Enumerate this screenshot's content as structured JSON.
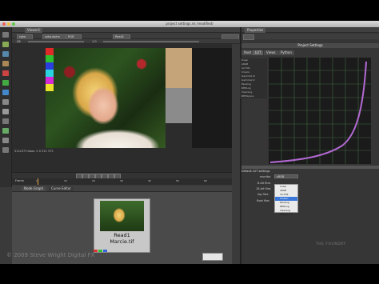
{
  "window": {
    "title": "project settings.nk (modified)"
  },
  "viewer": {
    "tab": "Viewer1",
    "controls": [
      "rgba",
      "rgba.alpha",
      "RGB",
      "Read1"
    ],
    "info": "512x373 bbox: 0 0 512 373",
    "gain_label": "f/8",
    "frame_label": "1.0"
  },
  "timeline": {
    "label": "Frame",
    "ticks": [
      "1",
      "10",
      "20",
      "30",
      "40",
      "50",
      "60"
    ]
  },
  "node_graph": {
    "tabs": [
      "Node Graph",
      "Curve Editor"
    ],
    "node": {
      "name": "Read1",
      "file": "Marcie.tif"
    }
  },
  "properties": {
    "title": "Properties",
    "panel_title": "Project Settings",
    "tabs": [
      "Root",
      "LUT",
      "Views",
      "Python"
    ],
    "lut_list": [
      "linear",
      "sRGB",
      "rec709",
      "Cineon",
      "Gamma1.8",
      "Gamma2.2",
      "Panalog",
      "REDLog",
      "ViperLog",
      "REDSpace"
    ],
    "default_label": "Default LUT settings",
    "fields": [
      {
        "label": "monitor",
        "value": "sRGB"
      },
      {
        "label": "8-bit files",
        "value": "sRGB"
      },
      {
        "label": "16-bit files",
        "value": "sRGB"
      },
      {
        "label": "log files",
        "value": "Cineon"
      },
      {
        "label": "float files",
        "value": "linear"
      }
    ],
    "popup_options": [
      "linear",
      "sRGB",
      "rec709",
      "Cineon",
      "Panalog",
      "REDLog",
      "ViperLog",
      "REDSpace"
    ],
    "popup_selected": "Cineon"
  },
  "watermark": {
    "copyright": "© 2009 Steve Wright Digital FX",
    "brand": "THE FOUNDRY"
  },
  "colors": {
    "curve": "#b36ad3",
    "grid": "#3f6a3f",
    "selection": "#3a77d8"
  }
}
